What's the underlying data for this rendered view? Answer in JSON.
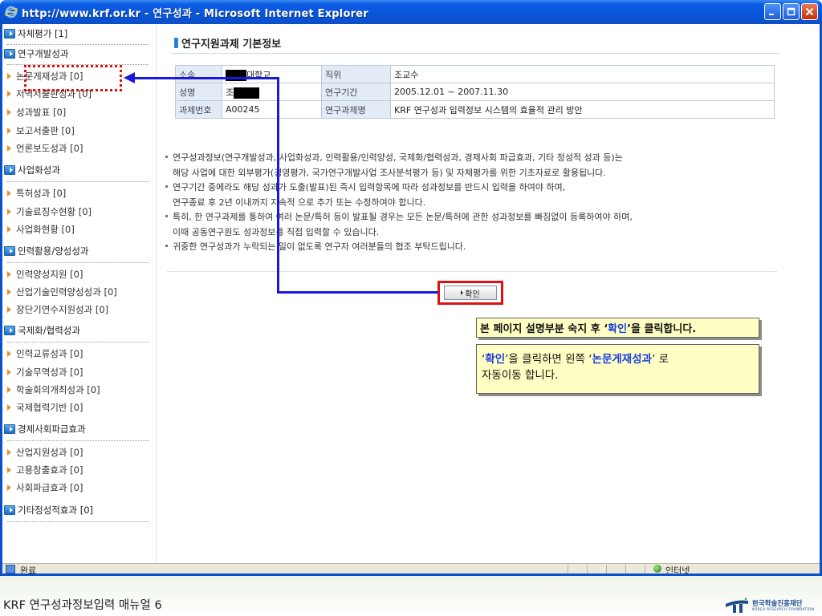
{
  "window": {
    "title": "http://www.krf.or.kr - 연구성과 - Microsoft Internet Explorer",
    "controls": [
      "minimize-icon",
      "maximize-icon",
      "close-icon"
    ]
  },
  "sidebar": {
    "items": [
      {
        "type": "section",
        "label": "자체평가 [1]"
      },
      {
        "type": "section",
        "label": "연구개발성과"
      },
      {
        "type": "item",
        "label": "논문게재성과 [0]"
      },
      {
        "type": "item",
        "label": "저역서출판성과 [0]"
      },
      {
        "type": "item",
        "label": "성과발표 [0]"
      },
      {
        "type": "item",
        "label": "보고서출판 [0]"
      },
      {
        "type": "item",
        "label": "언론보도성과 [0]"
      },
      {
        "type": "section",
        "label": "사업화성과"
      },
      {
        "type": "item",
        "label": "특허성과 [0]"
      },
      {
        "type": "item",
        "label": "기술료징수현황 [0]"
      },
      {
        "type": "item",
        "label": "사업화현황 [0]"
      },
      {
        "type": "section",
        "label": "인력활용/양성성과"
      },
      {
        "type": "item",
        "label": "인력양성지원 [0]"
      },
      {
        "type": "item",
        "label": "산업기술인력양성성과 [0]"
      },
      {
        "type": "item",
        "label": "장단기연수지원성과 [0]"
      },
      {
        "type": "section",
        "label": "국제화/협력성과"
      },
      {
        "type": "item",
        "label": "인력교류성과 [0]"
      },
      {
        "type": "item",
        "label": "기술무역성과 [0]"
      },
      {
        "type": "item",
        "label": "학술회의개최성과 [0]"
      },
      {
        "type": "item",
        "label": "국제협력기반 [0]"
      },
      {
        "type": "section",
        "label": "경제사회파급효과"
      },
      {
        "type": "item",
        "label": "산업지원성과 [0]"
      },
      {
        "type": "item",
        "label": "고용창출효과 [0]"
      },
      {
        "type": "item",
        "label": "사회파급효과 [0]"
      },
      {
        "type": "section",
        "label": "기타정성적효과 [0]"
      }
    ]
  },
  "main": {
    "title": "연구지원과제 기본정보",
    "info_table": {
      "rows": [
        [
          {
            "label": "소속",
            "value": "대학교"
          },
          {
            "label": "직위",
            "value": "조교수"
          }
        ],
        [
          {
            "label": "성명",
            "value": "조"
          },
          {
            "label": "연구기간",
            "value": "2005.12.01 ~ 2007.11.30"
          }
        ],
        [
          {
            "label": "과제번호",
            "value": "A00245"
          },
          {
            "label": "연구과제명",
            "value": "KRF 연구성과 입력정보 시스템의 효율적 관리 방안"
          }
        ]
      ]
    },
    "notes": [
      "연구성과정보(연구개발성과, 사업화성과, 인력활용/인력양성, 국제화/협력성과, 경제사회 파급효과, 기타 정성적 성과 등)는",
      "해당 사업에 대한 외부평가(경영평가, 국가연구개발사업 조사분석평가 등) 및 자체평가를 위한 기초자료로 활용됩니다.",
      "연구기간 중에라도 해당 성과가 도출(발표)된 즉시 입력항목에 따라 성과정보를 반드시 입력을 하여야 하며,",
      "연구종료 후 2년 이내까지 지속적 으로 추가 또는 수정하여야 합니다.",
      "특히, 한 연구과제를 통하여 여러 논문/특허 등이 발표될 경우는 모든 논문/특허에 관한 성과정보를 빠짐없이 등록하여야 하며,",
      "이때 공동연구원도 성과정보를 직접 입력할 수 있습니다.",
      "귀중한 연구성과가 누락되는 일이 없도록 연구자 여러분들의 협조 부탁드립니다."
    ],
    "confirm_label": "확인"
  },
  "callouts": {
    "first_pre": "본 페이지 설명부분 숙지 후 ‘",
    "first_hl": "확인",
    "first_post": "’을 클릭합니다.",
    "second_q1": "‘",
    "second_hl1": "확인",
    "second_mid": "’을 클릭하면 왼쪽 ‘",
    "second_hl2": "논문게재성과",
    "second_post": "’ 로",
    "second_line2": "자동이동 합니다."
  },
  "statusbar": {
    "status": "완료",
    "zone": "인터넷"
  },
  "footer": {
    "caption": "KRF 연구성과정보입력 매뉴얼 6",
    "logo_name": "한국학술진흥재단",
    "logo_sub": "KOREA RESEARCH FOUNDATION"
  },
  "colors": {
    "titlebar": "#0b5ce5",
    "annotation_red": "#e01010",
    "annotation_blue": "#1818e0",
    "callout_bg": "#ffffc4",
    "highlight_text": "#1a3de0"
  }
}
